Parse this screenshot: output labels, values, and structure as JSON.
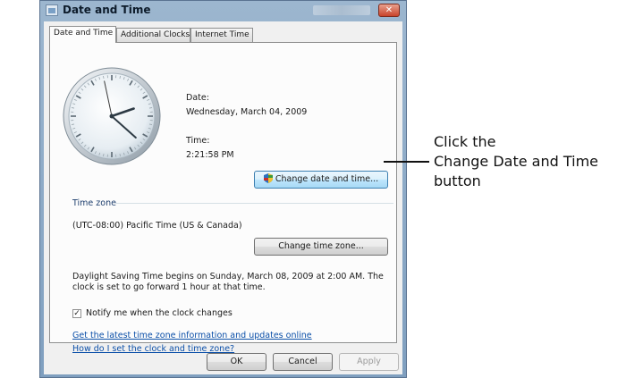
{
  "window": {
    "title": "Date and Time",
    "close_glyph": "✕"
  },
  "tabs": [
    {
      "label": "Date and Time",
      "active": true
    },
    {
      "label": "Additional Clocks",
      "active": false
    },
    {
      "label": "Internet Time",
      "active": false
    }
  ],
  "clock": {
    "hour": 2,
    "minute": 21,
    "second": 58
  },
  "date": {
    "label": "Date:",
    "value": "Wednesday, March 04, 2009"
  },
  "time": {
    "label": "Time:",
    "value": "2:21:58 PM"
  },
  "buttons": {
    "change_datetime": "Change date and time...",
    "change_timezone": "Change time zone...",
    "ok": "OK",
    "cancel": "Cancel",
    "apply": "Apply"
  },
  "timezone": {
    "section_label": "Time zone",
    "value": "(UTC-08:00) Pacific Time (US & Canada)"
  },
  "dst": {
    "line1": "Daylight Saving Time begins on Sunday, March 08, 2009 at 2:00 AM. The",
    "line2": "clock is set to go forward 1 hour at that time."
  },
  "notify": {
    "label": "Notify me when the clock changes",
    "checked": true,
    "check_glyph": "✓"
  },
  "links": {
    "latest": "Get the latest time zone information and updates online",
    "howto": "How do I set the clock and time zone?"
  },
  "callout": {
    "line1": "Click the",
    "line2": "Change Date and Time",
    "line3": "button"
  },
  "colors": {
    "link": "#0b4fa8",
    "title_bar": "#9cb6cf",
    "close_button": "#c8432b"
  }
}
